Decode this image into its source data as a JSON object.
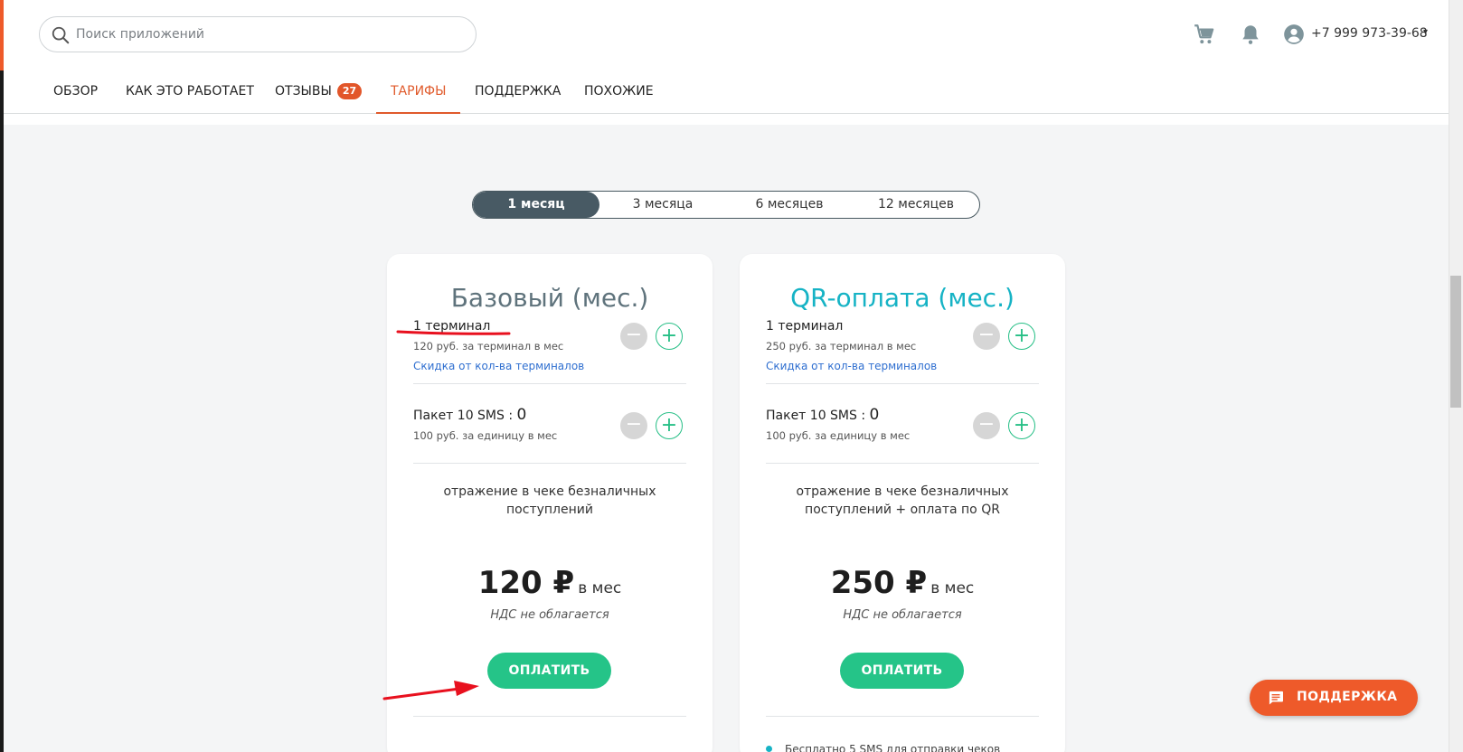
{
  "colors": {
    "accent": "#ee5a2a",
    "nav_active": "#e05a2b",
    "title_basic": "#5f737c",
    "title_qr": "#16b3c5",
    "pay_button": "#25c488",
    "period_active": "#485a64",
    "annotation": "#e8101e"
  },
  "header": {
    "search_placeholder": "Поиск приложений",
    "cart_icon": "cart-icon",
    "bell_icon": "bell-icon",
    "user_icon": "account-icon",
    "phone": "+7 999 973-39-68",
    "caret": "▾"
  },
  "nav": {
    "items": [
      {
        "label": "ОБЗОР"
      },
      {
        "label": "КАК ЭТО РАБОТАЕТ"
      },
      {
        "label": "ОТЗЫВЫ",
        "badge": "27"
      },
      {
        "label": "ТАРИФЫ",
        "active": true
      },
      {
        "label": "ПОДДЕРЖКА"
      },
      {
        "label": "ПОХОЖИЕ"
      }
    ]
  },
  "periods": {
    "items": [
      "1 месяц",
      "3 месяца",
      "6 месяцев",
      "12 месяцев"
    ],
    "selected": "1 месяц"
  },
  "plans": [
    {
      "title": "Базовый (мес.)",
      "terminal": {
        "label": "1 терминал",
        "sub": "120 руб. за терминал в мес",
        "link": "Скидка от кол-ва терминалов"
      },
      "sms": {
        "label": "Пакет 10 SMS : ",
        "count": "0",
        "sub": "100 руб. за единицу в мес"
      },
      "description": "отражение в чеке безналичных поступлений",
      "price": "120 ₽",
      "price_unit": "в мес",
      "vat": "НДС не облагается",
      "pay_label": "ОПЛАТИТЬ"
    },
    {
      "title": "QR-оплата (мес.)",
      "terminal": {
        "label": "1 терминал",
        "sub": "250 руб. за терминал в мес",
        "link": "Скидка от кол-ва терминалов"
      },
      "sms": {
        "label": "Пакет 10 SMS : ",
        "count": "0",
        "sub": "100 руб. за единицу в мес"
      },
      "description": "отражение в чеке безналичных поступлений + оплата по QR",
      "price": "250 ₽",
      "price_unit": "в мес",
      "vat": "НДС не облагается",
      "pay_label": "ОПЛАТИТЬ",
      "feature": "Бесплатно 5 SMS для отправки чеков"
    }
  ],
  "stepper": {
    "minus": "−",
    "plus": "+"
  },
  "support_button": {
    "label": "ПОДДЕРЖКА",
    "icon": "chat-icon"
  }
}
